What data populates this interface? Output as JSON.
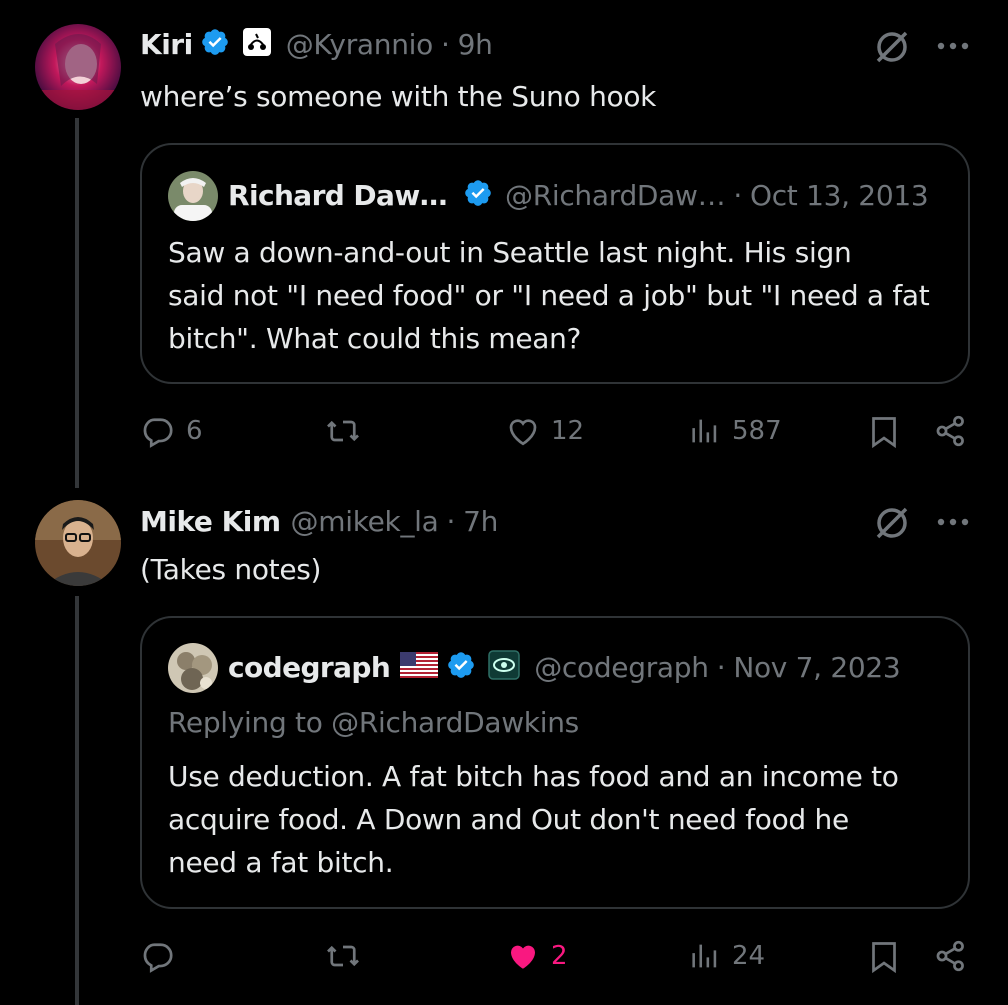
{
  "colors": {
    "verified": "#1d9bf0",
    "muted": "#71767b",
    "like_active": "#f91880",
    "text": "#e7e9ea"
  },
  "posts": [
    {
      "name": "Kiri",
      "handle": "@Kyrannio",
      "sep": "·",
      "time": "9h",
      "text": "where’s someone with the Suno hook",
      "quote": {
        "name": "Richard Daw…",
        "handle": "@RichardDaw…",
        "sep": "·",
        "date": "Oct 13, 2013",
        "lines": [
          "Saw a down-and-out in Seattle last night. His sign",
          "said not \"I need food\" or \"I need a job\" but \"I need a fat",
          "bitch\". What could this mean?"
        ]
      },
      "actions": {
        "replies": "6",
        "likes": "12",
        "views": "587"
      }
    },
    {
      "name": "Mike Kim",
      "handle": "@mikek_la",
      "sep": "·",
      "time": "7h",
      "text": "(Takes notes)",
      "quote": {
        "name": "codegraph",
        "handle": "@codegraph",
        "sep": "·",
        "date": "Nov 7, 2023",
        "replying": "Replying to @RichardDawkins",
        "lines": [
          "Use deduction. A fat bitch has food and an income to",
          "acquire food. A Down and Out don't need food he",
          "need a fat bitch."
        ]
      },
      "actions": {
        "replies": "",
        "likes": "2",
        "views": "24"
      }
    }
  ],
  "icons": [
    "verified-badge-icon",
    "grok-icon",
    "more-icon",
    "reply-icon",
    "retweet-icon",
    "like-icon",
    "views-icon",
    "bookmark-icon",
    "share-icon",
    "us-flag-icon",
    "affiliate-eye-icon"
  ]
}
